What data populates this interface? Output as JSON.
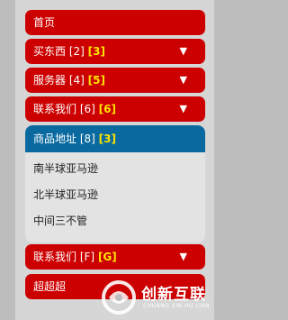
{
  "menu": {
    "items": [
      {
        "label": "首页",
        "count": "",
        "highlight": "",
        "arrow": ""
      },
      {
        "label": "买东西",
        "count": "[2]",
        "highlight": "[3]",
        "arrow": "▼"
      },
      {
        "label": "服务器",
        "count": "[4]",
        "highlight": "[5]",
        "arrow": "▼"
      },
      {
        "label": "联系我们",
        "count": "[6]",
        "highlight": "[6]",
        "arrow": "▼"
      },
      {
        "label": "联系我们",
        "count": "[F]",
        "highlight": "[G]",
        "arrow": "▼"
      },
      {
        "label": "超超超",
        "count": "",
        "highlight": "",
        "arrow": ""
      }
    ],
    "submenu": {
      "active": {
        "label": "商品地址",
        "count": "[8]",
        "highlight": "[3]"
      },
      "items": [
        "南半球亚马逊",
        "北半球亚马逊",
        "中间三不管"
      ]
    }
  },
  "watermark": {
    "name": "创新互联",
    "subtitle": "CHUANG XIN HU LIAN"
  },
  "colors": {
    "menu_red": "#cc0000",
    "active_blue": "#0a6aa0",
    "highlight_yellow": "#ffe400",
    "panel_gray": "#d6d6d6"
  }
}
